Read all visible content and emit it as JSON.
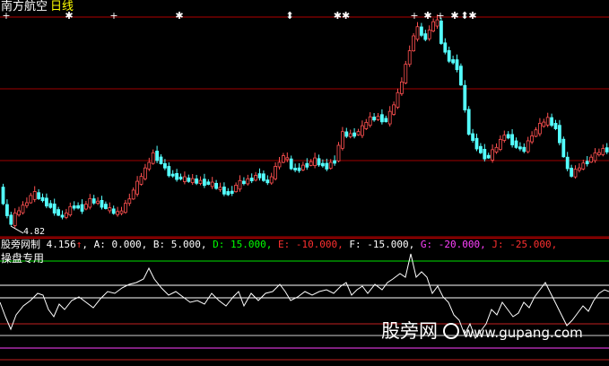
{
  "header": {
    "stock_name": "南方航空",
    "period": "日线"
  },
  "price_panel": {
    "low_marker_text": "4.82",
    "rise_color": "#ff5050",
    "fall_color": "#54ffff",
    "signal_markers": [
      "+",
      "✱",
      "+",
      "✱",
      "⬍",
      "✱✱",
      "+",
      "✱",
      "+",
      "✱",
      "⬍",
      "✱"
    ]
  },
  "indicator_header": {
    "name": "股旁网制",
    "value": "4.156",
    "arrow": "↑",
    "params": [
      {
        "text": ", A: 0.000,",
        "color": "#ffffff"
      },
      {
        "text": " B: 5.000,",
        "color": "#ffffff"
      },
      {
        "text": " D: 15.000,",
        "color": "#00ff00"
      },
      {
        "text": " E: -10.000,",
        "color": "#ff3030"
      },
      {
        "text": " F: -15.000,",
        "color": "#ffffff"
      },
      {
        "text": " G: -20.000,",
        "color": "#ff40ff"
      },
      {
        "text": " J: -25.000,",
        "color": "#ff3030"
      }
    ],
    "sub_label": "操盘专用"
  },
  "watermark": {
    "cn": "股旁网",
    "url": "www.gupang.com"
  }
}
